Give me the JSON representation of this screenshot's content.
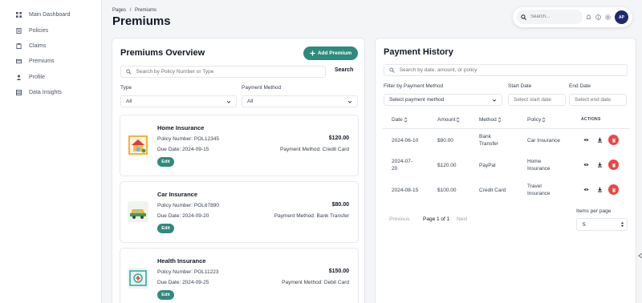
{
  "sidebar": {
    "items": [
      {
        "label": "Main Dashboard",
        "icon": "grid-icon"
      },
      {
        "label": "Policies",
        "icon": "document-icon"
      },
      {
        "label": "Claims",
        "icon": "clipboard-icon"
      },
      {
        "label": "Premiums",
        "icon": "credit-card-icon"
      },
      {
        "label": "Profile",
        "icon": "user-icon"
      },
      {
        "label": "Data Insights",
        "icon": "table-icon"
      }
    ]
  },
  "header": {
    "breadcrumb_root": "Pages",
    "breadcrumb_sep": "/",
    "breadcrumb_current": "Premiums",
    "title": "Premiums"
  },
  "topbar": {
    "search_placeholder": "Search...",
    "avatar_initials": "AP"
  },
  "overview": {
    "title": "Premiums Overview",
    "add_button": "Add Premium",
    "search_placeholder": "Search by Policy Number or Type",
    "search_button": "Search",
    "type_label": "Type",
    "type_value": "All",
    "method_label": "Payment Method",
    "method_value": "All",
    "cards": [
      {
        "title": "Home Insurance",
        "policy": "Policy Number: POL12345",
        "due": "Due Date: 2024-09-15",
        "amount": "$120.00",
        "method": "Payment Method: Credit Card",
        "edit": "Edit"
      },
      {
        "title": "Car Insurance",
        "policy": "Policy Number: POL67890",
        "due": "Due Date: 2024-09-20",
        "amount": "$80.00",
        "method": "Payment Method: Bank Transfer",
        "edit": "Edit"
      },
      {
        "title": "Health Insurance",
        "policy": "Policy Number: POL11223",
        "due": "Due Date: 2024-09-25",
        "amount": "$150.00",
        "method": "Payment Method: Debit Card",
        "edit": "Edit"
      }
    ]
  },
  "history": {
    "title": "Payment History",
    "search_placeholder": "Search by date, amount, or policy",
    "filter_label": "Filter by Payment Method",
    "filter_value": "Select payment method",
    "start_label": "Start Date",
    "start_placeholder": "Select start date",
    "end_label": "End Date",
    "end_placeholder": "Select end date",
    "columns": {
      "date": "Date",
      "amount": "Amount",
      "method": "Method",
      "policy": "Policy",
      "actions": "ACTIONS"
    },
    "rows": [
      {
        "date": "2024-06-10",
        "amount": "$90.00",
        "method_1": "Bank",
        "method_2": "Transfer",
        "policy_1": "Car Insurance",
        "policy_2": ""
      },
      {
        "date_1": "2024-07-",
        "date_2": "20",
        "amount": "$120.00",
        "method_1": "PayPal",
        "method_2": "",
        "policy_1": "Home",
        "policy_2": "Insurance"
      },
      {
        "date": "2024-08-15",
        "amount": "$100.00",
        "method_1": "Credit Card",
        "method_2": "",
        "policy_1": "Travel",
        "policy_2": "Insurance"
      }
    ],
    "pager": {
      "previous": "Previous",
      "info": "Page 1 of 1",
      "next": "Next"
    },
    "items_per_page_label": "Items per page",
    "items_per_page_value": "5"
  },
  "colors": {
    "accent": "#2f8a7e",
    "danger": "#ef4444",
    "avatar": "#1e2a6e"
  }
}
